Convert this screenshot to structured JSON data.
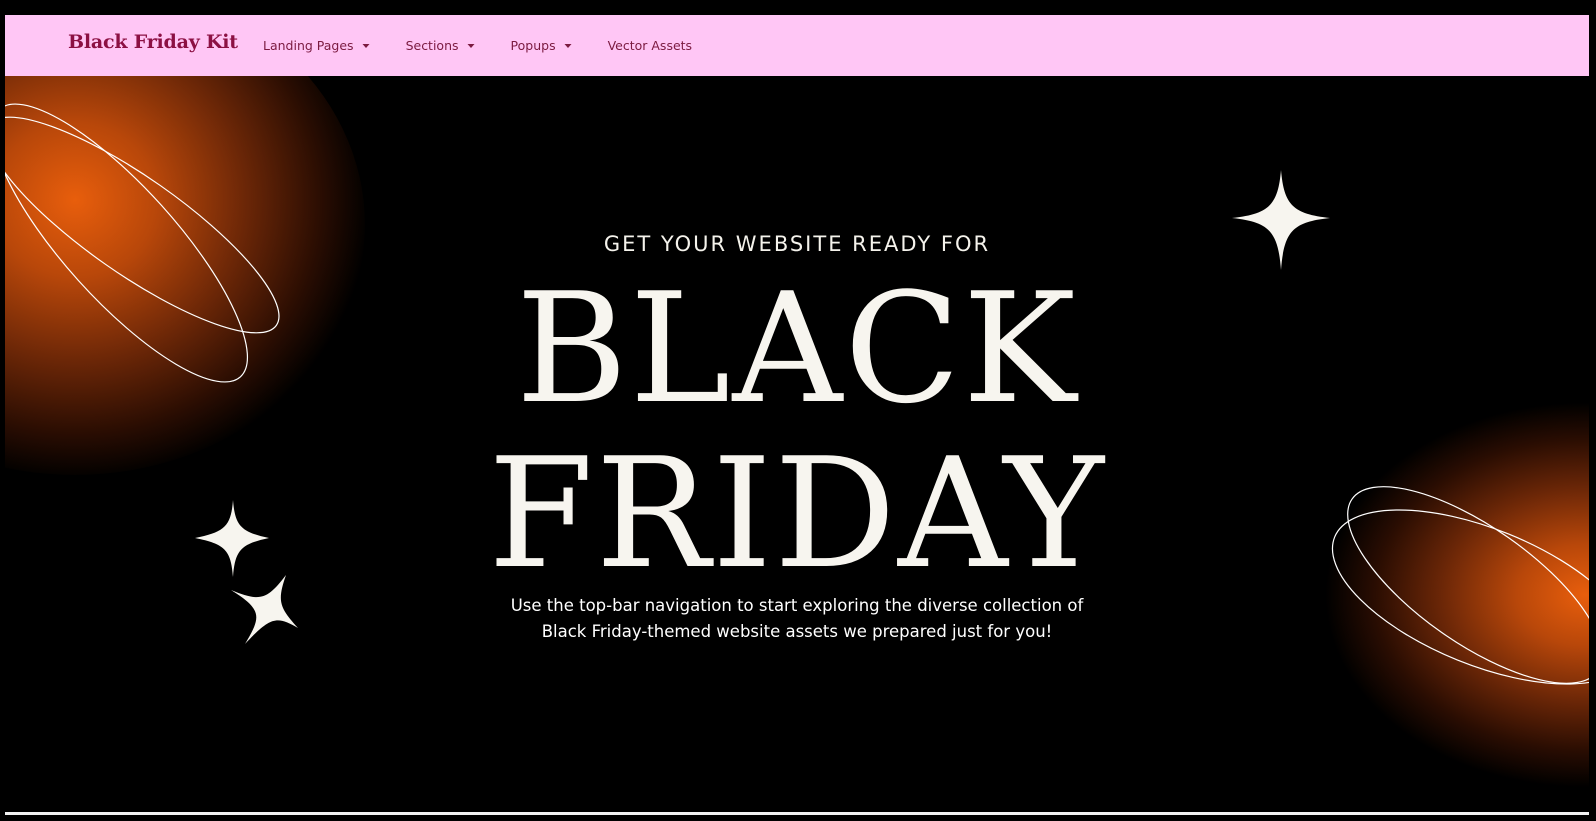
{
  "topbar": {
    "brand": "Black Friday Kit",
    "nav": [
      {
        "label": "Landing Pages",
        "has_dropdown": true
      },
      {
        "label": "Sections",
        "has_dropdown": true
      },
      {
        "label": "Popups",
        "has_dropdown": true
      },
      {
        "label": "Vector Assets",
        "has_dropdown": false
      }
    ]
  },
  "hero": {
    "eyebrow": "GET YOUR WEBSITE READY FOR",
    "headline_line1": "BLACK",
    "headline_line2": "FRIDAY",
    "lede_line1": "Use the top-bar navigation to start exploring the diverse collection of",
    "lede_line2": "Black Friday-themed website assets we prepared just for you!"
  },
  "colors": {
    "topbar_bg": "#ffc6f5",
    "brand_text": "#8c1043",
    "nav_text": "#7b1a40",
    "page_bg": "#000000",
    "headline_text": "#f7f5ef",
    "glow": "#e85e0c"
  },
  "icons": {
    "caret": "chevron-down-icon",
    "sparkle": "sparkle-icon"
  }
}
